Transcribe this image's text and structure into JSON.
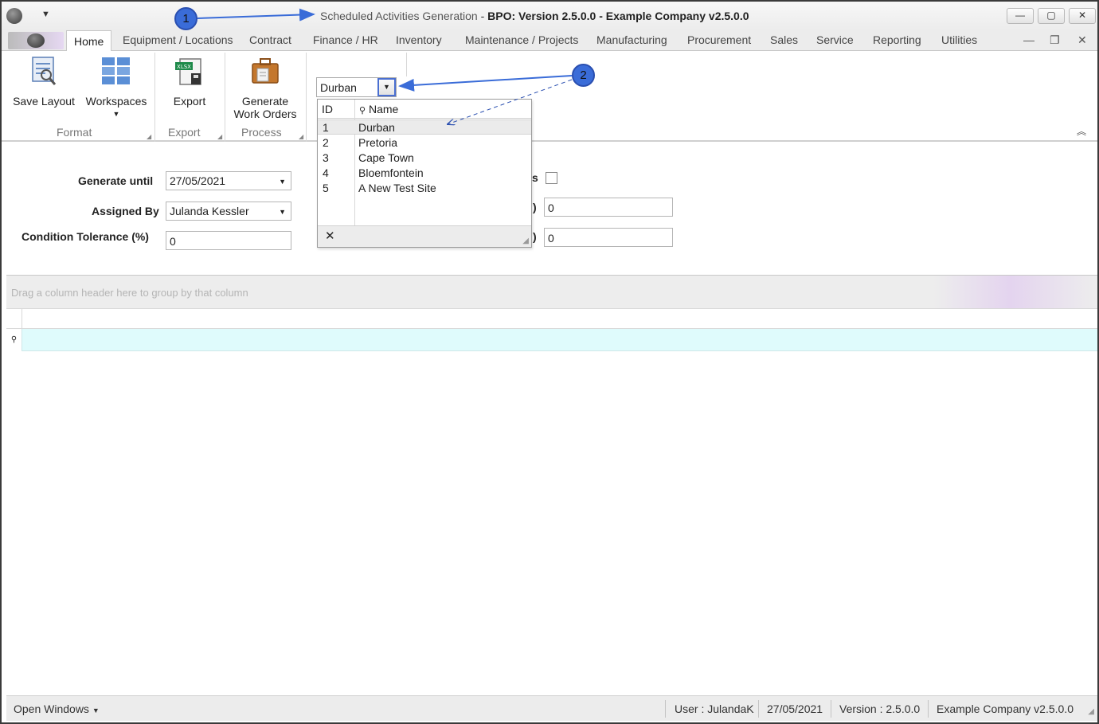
{
  "window": {
    "title_part1": "Scheduled Activities Generation",
    "title_part2": "BPO: Version 2.5.0.0 - Example Company v2.5.0.0",
    "title_sep": " - ",
    "minimize": "—",
    "maximize": "▢",
    "close": "✕"
  },
  "tabs": [
    {
      "label": "Home"
    },
    {
      "label": "Equipment / Locations"
    },
    {
      "label": "Contract"
    },
    {
      "label": "Finance / HR"
    },
    {
      "label": "Inventory"
    },
    {
      "label": "Maintenance / Projects"
    },
    {
      "label": "Manufacturing"
    },
    {
      "label": "Procurement"
    },
    {
      "label": "Sales"
    },
    {
      "label": "Service"
    },
    {
      "label": "Reporting"
    },
    {
      "label": "Utilities"
    }
  ],
  "ribbon": {
    "save_layout": "Save Layout",
    "workspaces": "Workspaces",
    "export": "Export",
    "generate_line1": "Generate",
    "generate_line2": "Work Orders",
    "group_format": "Format",
    "group_export": "Export",
    "group_process": "Process",
    "xlsx_badge": "XLSX"
  },
  "site_selector": {
    "value": "Durban",
    "columns": {
      "id": "ID",
      "name": "Name"
    },
    "rows": [
      {
        "id": "1",
        "name": "Durban"
      },
      {
        "id": "2",
        "name": "Pretoria"
      },
      {
        "id": "3",
        "name": "Cape Town"
      },
      {
        "id": "4",
        "name": "Bloemfontein"
      },
      {
        "id": "5",
        "name": "A New Test Site"
      }
    ],
    "close_label": "✕"
  },
  "form": {
    "generate_until_label": "Generate until",
    "generate_until_value": "27/05/2021",
    "assigned_by_label": "Assigned By",
    "assigned_by_value": "Julanda Kessler",
    "condition_tolerance_label": "Condition Tolerance (%)",
    "condition_tolerance_value": "0",
    "hidden_label_1_tail": "s",
    "hidden_label_2_tail": ")",
    "hidden_label_3_tail": ")",
    "right_value_1": "0",
    "right_value_2": "0"
  },
  "grid": {
    "group_hint": "Drag a column header here to group by that column"
  },
  "statusbar": {
    "open_windows": "Open Windows",
    "user": "User : JulandaK",
    "date": "27/05/2021",
    "version": "Version : 2.5.0.0",
    "company": "Example Company v2.5.0.0"
  },
  "annotations": {
    "callout_1": "1",
    "callout_2": "2"
  }
}
